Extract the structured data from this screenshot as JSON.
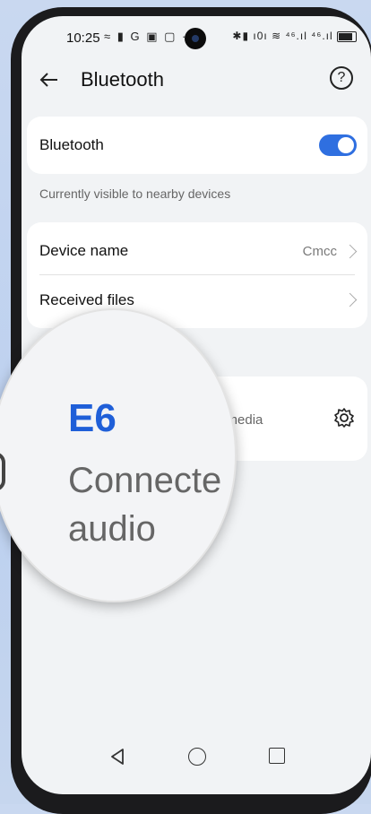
{
  "statusbar": {
    "time": "10:25",
    "left_icons": "≈ ▮ G ▣ ▢ ··",
    "right_icons": "✱▮ ı0ı ≋ ⁴⁶.ıl ⁴⁶.ıl"
  },
  "header": {
    "title": "Bluetooth",
    "help_glyph": "?"
  },
  "bluetooth_toggle": {
    "label": "Bluetooth",
    "enabled": true,
    "accent": "#2f6fe0"
  },
  "visibility_caption": "Currently visible to nearby devices",
  "settings": {
    "device_name_label": "Device name",
    "device_name_value": "Cmcc",
    "received_files_label": "Received files"
  },
  "paired_device": {
    "name": "E6",
    "status_line1": "Connecte",
    "status_line2": "audio",
    "partial_status": "d media"
  },
  "navbar": {
    "back": "back-nav",
    "home": "home-nav",
    "recent": "recent-nav"
  }
}
